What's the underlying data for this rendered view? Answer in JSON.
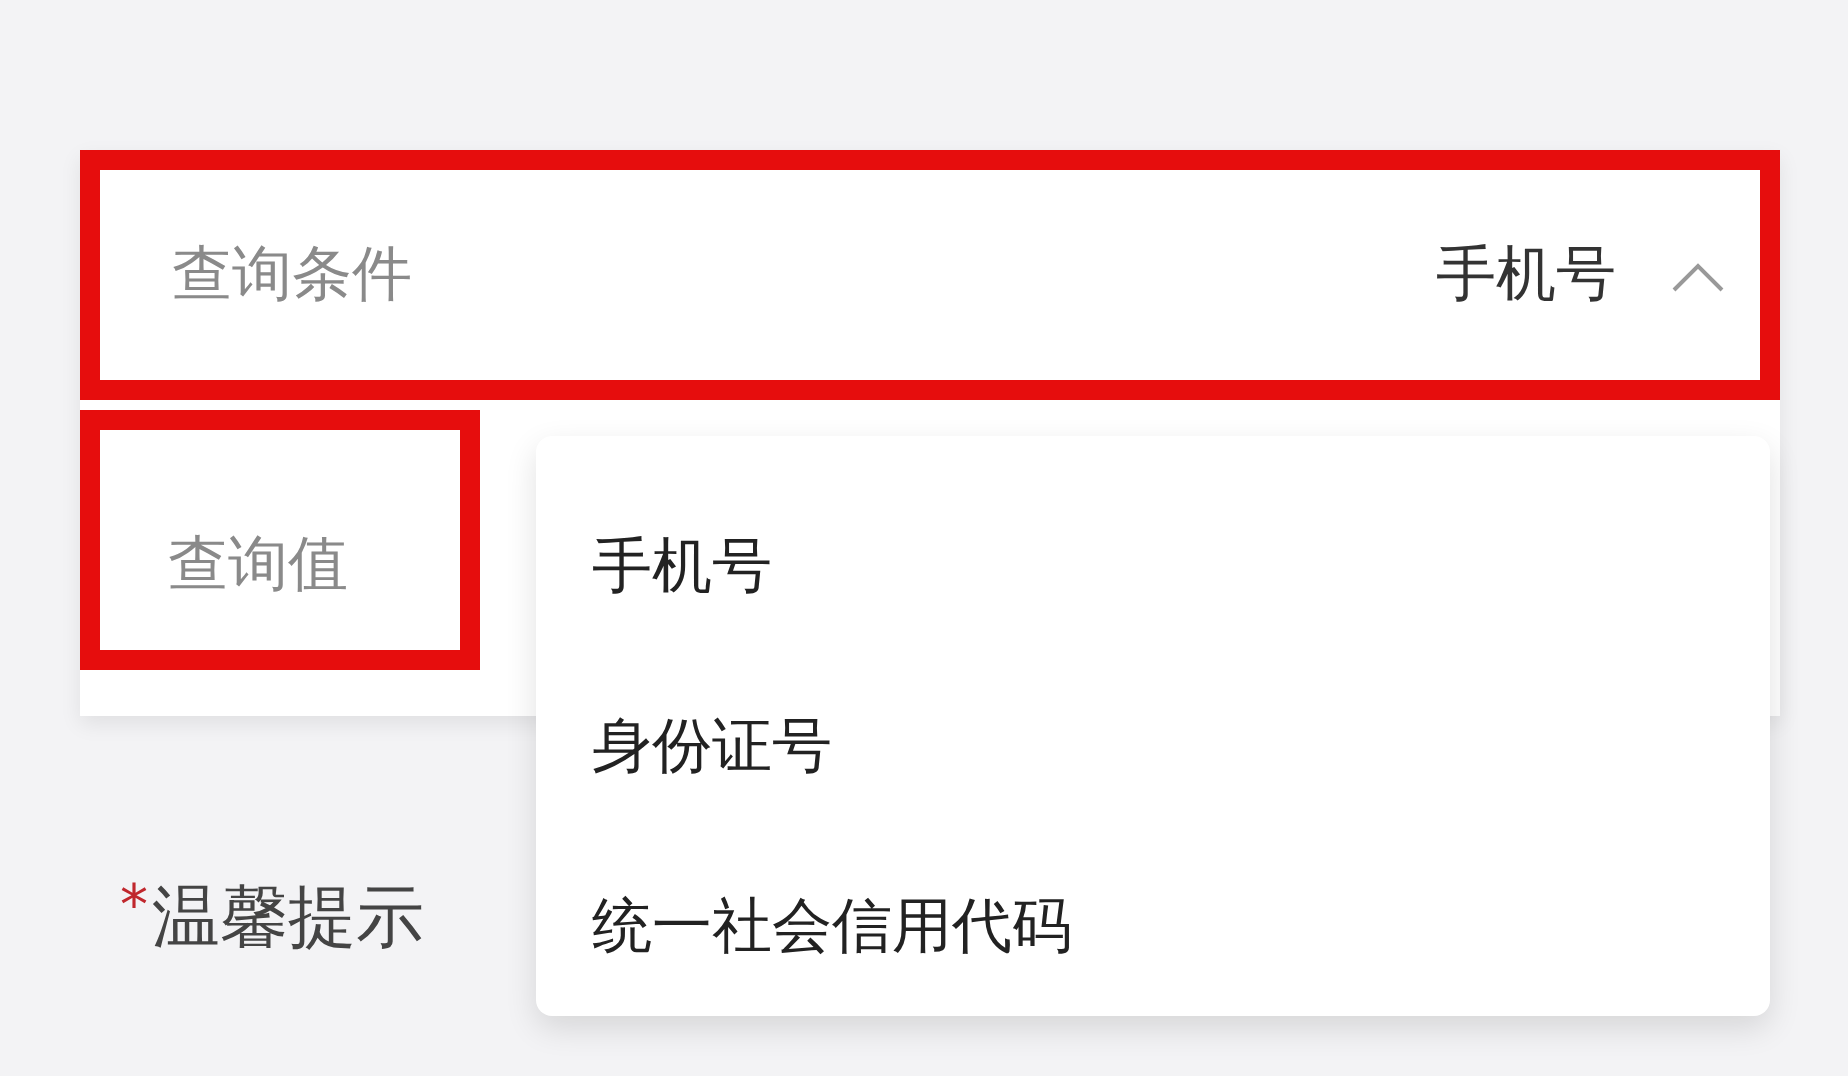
{
  "query_condition": {
    "label": "查询条件",
    "value": "手机号",
    "expanded": true
  },
  "query_value": {
    "label": "查询值"
  },
  "dropdown": {
    "options": [
      {
        "label": "手机号"
      },
      {
        "label": "身份证号"
      },
      {
        "label": "统一社会信用代码"
      }
    ]
  },
  "tip": {
    "mark": "*",
    "label": "温馨提示"
  }
}
